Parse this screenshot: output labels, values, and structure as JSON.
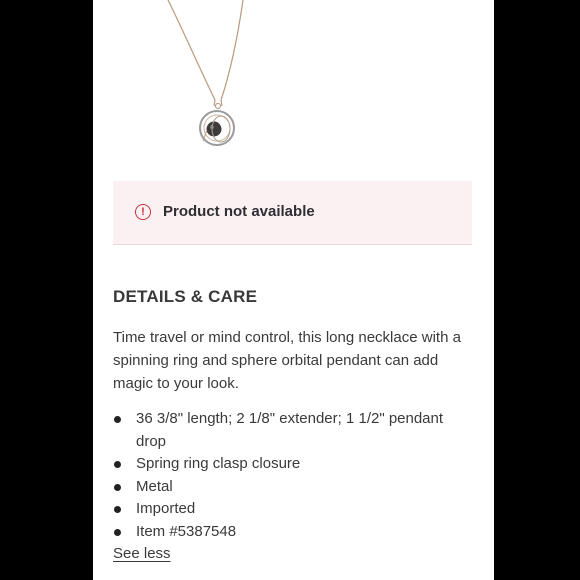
{
  "alert": {
    "icon": "exclamation-circle-icon",
    "text": "Product not available",
    "color": "#c4333d"
  },
  "details": {
    "title": "DETAILS & CARE",
    "description": "Time travel or mind control, this long necklace with a spinning ring and sphere orbital pendant can add magic to your look.",
    "bullets": [
      "36 3/8\" length; 2 1/8\" extender; 1 1/2\" pendant drop",
      "Spring ring clasp closure",
      "Metal",
      "Imported",
      "Item #5387548"
    ],
    "see_less_label": "See less"
  }
}
